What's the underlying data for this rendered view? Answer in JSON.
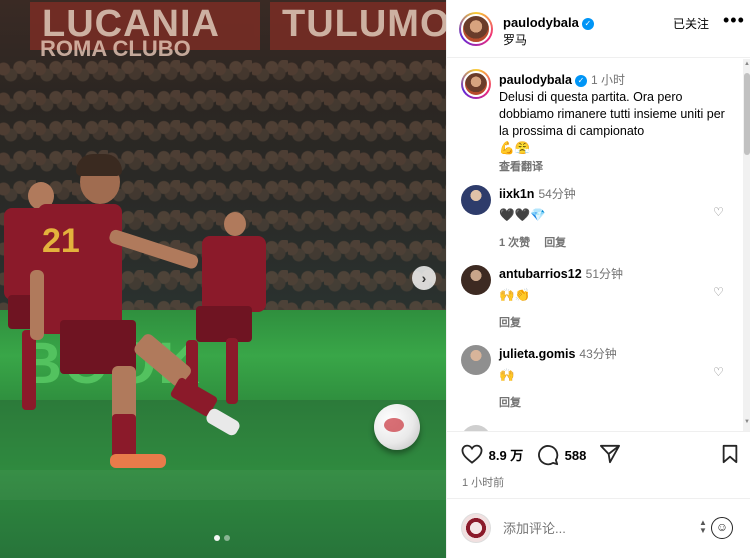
{
  "photo": {
    "banner_left": "LUCANIA",
    "banner_left_sub": "ROMA CLUBO",
    "banner_right": "TULUMO",
    "ad_board": "BOOK",
    "shirt_number": "21",
    "next_icon": "chevron-right-icon",
    "carousel_dots": 2,
    "carousel_active": 0
  },
  "header": {
    "username": "paulodybala",
    "location": "罗马",
    "follow_status": "已关注",
    "more_icon": "more-horizontal-icon"
  },
  "caption": {
    "username": "paulodybala",
    "time": "1 小时",
    "text": "Delusi di questa partita. Ora pero dobbiamo rimanere tutti insieme uniti per la prossima di campionato",
    "emojis": "💪😤",
    "translate": "查看翻译"
  },
  "comments": [
    {
      "username": "iixk1n",
      "time": "54分钟",
      "text": "🖤🖤💎",
      "likes": "1 次赞",
      "reply": "回复"
    },
    {
      "username": "antubarrios12",
      "time": "51分钟",
      "text": "🙌👏",
      "likes": "",
      "reply": "回复"
    },
    {
      "username": "julieta.gomis",
      "time": "43分钟",
      "text": "🙌",
      "likes": "",
      "reply": "回复"
    }
  ],
  "actions": {
    "likes": "8.9 万",
    "comments": "588",
    "post_time": "1 小时前"
  },
  "add_comment": {
    "placeholder": "添加评论..."
  },
  "colors": {
    "verified": "#0095f6",
    "roma_red": "#8b1a2a",
    "gold": "#e3b23c",
    "ad_green": "#39a648"
  }
}
